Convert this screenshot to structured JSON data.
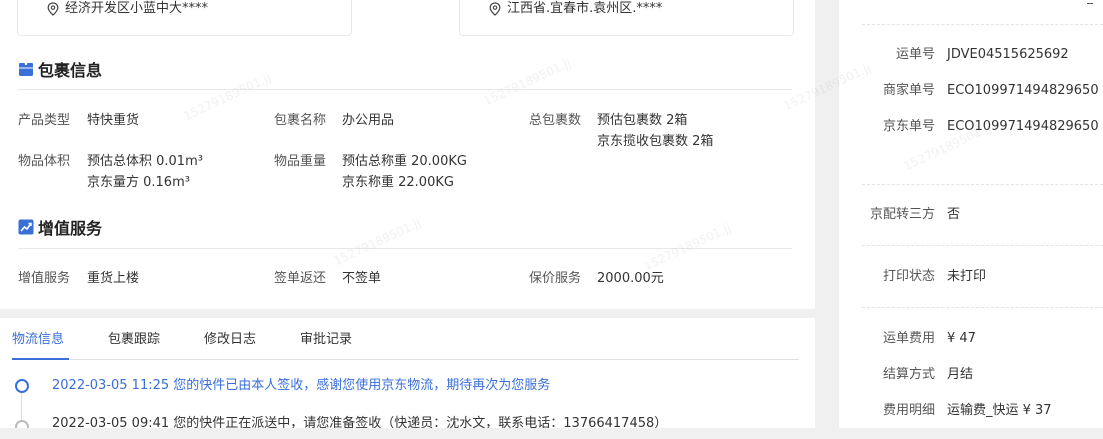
{
  "sender": {
    "address": "经济开发区小蓝中大****"
  },
  "receiver": {
    "address": "江西省.宜春市.袁州区.****"
  },
  "package_section": {
    "title": "包裹信息",
    "product_type_label": "产品类型",
    "product_type_value": "特快重货",
    "package_name_label": "包裹名称",
    "package_name_value": "办公用品",
    "total_packages_label": "总包裹数",
    "total_packages_line1": "预估包裹数 2箱",
    "total_packages_line2": "京东揽收包裹数 2箱",
    "volume_label": "物品体积",
    "volume_line1": "预估总体积 0.01m³",
    "volume_line2": "京东量方 0.16m³",
    "weight_label": "物品重量",
    "weight_line1": "预估总称重 20.00KG",
    "weight_line2": "京东称重 22.00KG"
  },
  "value_added_section": {
    "title": "增值服务",
    "service_label": "增值服务",
    "service_value": "重货上楼",
    "return_label": "签单返还",
    "return_value": "不签单",
    "insurance_label": "保价服务",
    "insurance_value": "2000.00元"
  },
  "tabs": [
    "物流信息",
    "包裹跟踪",
    "修改日志",
    "审批记录"
  ],
  "timeline": [
    {
      "text": "2022-03-05 11:25 您的快件已由本人签收，感谢您使用京东物流，期待再次为您服务"
    },
    {
      "text": "2022-03-05 09:41 您的快件正在派送中，请您准备签收（快递员：沈水文，联系电话：13766417458）"
    }
  ],
  "right_panel": {
    "waybill_label": "运单号",
    "waybill_value": "JDVE04515625692",
    "merchant_label": "商家单号",
    "merchant_value": "ECO109971494829650",
    "jd_label": "京东单号",
    "jd_value": "ECO109971494829650",
    "third_party_label": "京配转三方",
    "third_party_value": "否",
    "print_label": "打印状态",
    "print_value": "未打印",
    "fee_label": "运单费用",
    "fee_value": "¥ 47",
    "settlement_label": "结算方式",
    "settlement_value": "月结",
    "fee_detail_label": "费用明细",
    "fee_detail_value": "运输费_快运 ¥ 37"
  },
  "watermark_text": "15279189501.jj",
  "colors": {
    "accent": "#3a6fd8",
    "background": "#f0f0f0"
  }
}
